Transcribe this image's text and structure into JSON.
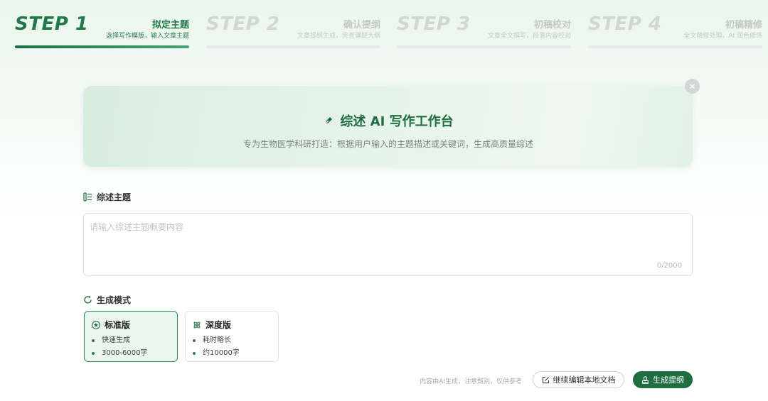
{
  "steps": [
    {
      "num": "STEP 1",
      "title": "拟定主题",
      "subtitle": "选择写作模版，输入文章主题",
      "active": true
    },
    {
      "num": "STEP 2",
      "title": "确认提纲",
      "subtitle": "文章提纲生成，完善课题大纲",
      "active": false
    },
    {
      "num": "STEP 3",
      "title": "初稿校对",
      "subtitle": "文章全文撰写，段落内容校对",
      "active": false
    },
    {
      "num": "STEP 4",
      "title": "初稿精修",
      "subtitle": "全文精修处理，AI 润色修饰",
      "active": false
    }
  ],
  "banner": {
    "title": "综述 AI 写作工作台",
    "subtitle": "专为生物医学科研打造：根据用户输入的主题描述或关键词，生成高质量综述",
    "close_icon": "close-icon"
  },
  "topic": {
    "label": "综述主题",
    "placeholder": "请输入综述主题概要内容",
    "value": "",
    "counter": "0/2000"
  },
  "mode": {
    "label": "生成模式",
    "options": [
      {
        "name": "标准版",
        "icon": "star-badge-icon",
        "points": [
          "快速生成",
          "3000-6000字"
        ],
        "selected": true
      },
      {
        "name": "深度版",
        "icon": "atom-icon",
        "points": [
          "耗时略长",
          "约10000字"
        ],
        "selected": false
      }
    ]
  },
  "footer": {
    "disclaimer": "内容由AI生成，注意甄别，仅供参考",
    "continue_label": "继续编辑本地文档",
    "generate_label": "生成提纲"
  },
  "colors": {
    "brand": "#1f6e42",
    "accent": "#2f8a57",
    "inactive": "#d2d7d4"
  }
}
